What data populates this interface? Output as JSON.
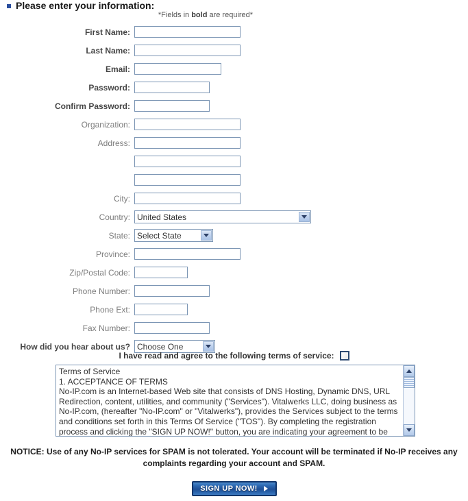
{
  "header": {
    "title": "Please enter your information:",
    "required_note_prefix": "*Fields in ",
    "required_note_bold": "bold",
    "required_note_suffix": " are required*"
  },
  "form": {
    "fields": [
      {
        "label": "First Name:",
        "required": true,
        "value": "",
        "type": "text"
      },
      {
        "label": "Last Name:",
        "required": true,
        "value": "",
        "type": "text"
      },
      {
        "label": "Email:",
        "required": true,
        "value": "",
        "type": "text"
      },
      {
        "label": "Password:",
        "required": true,
        "value": "",
        "type": "text"
      },
      {
        "label": "Confirm Password:",
        "required": true,
        "value": "",
        "type": "text"
      },
      {
        "label": "Organization:",
        "required": false,
        "value": "",
        "type": "text"
      },
      {
        "label": "Address:",
        "required": false,
        "value": "",
        "type": "text"
      },
      {
        "label": "",
        "required": false,
        "value": "",
        "type": "text"
      },
      {
        "label": "",
        "required": false,
        "value": "",
        "type": "text"
      },
      {
        "label": "City:",
        "required": false,
        "value": "",
        "type": "text"
      },
      {
        "label": "Country:",
        "required": false,
        "value": "United States",
        "type": "select"
      },
      {
        "label": "State:",
        "required": false,
        "value": "Select State",
        "type": "select"
      },
      {
        "label": "Province:",
        "required": false,
        "value": "",
        "type": "text"
      },
      {
        "label": "Zip/Postal Code:",
        "required": false,
        "value": "",
        "type": "text"
      },
      {
        "label": "Phone Number:",
        "required": false,
        "value": "",
        "type": "text"
      },
      {
        "label": "Phone Ext:",
        "required": false,
        "value": "",
        "type": "text"
      },
      {
        "label": "Fax Number:",
        "required": false,
        "value": "",
        "type": "text"
      },
      {
        "label": "How did you hear about us?",
        "required": true,
        "value": "Choose One",
        "type": "select"
      }
    ]
  },
  "agreement": {
    "label": "I have read and agree to the following terms of service:",
    "checked": false
  },
  "terms": {
    "text": "Terms of Service\n1. ACCEPTANCE OF TERMS\nNo-IP.com is an Internet-based Web site that consists of DNS Hosting, Dynamic DNS, URL Redirection, content, utilities, and community (\"Services\"). Vitalwerks LLC, doing business as No-IP.com, (hereafter \"No-IP.com\" or \"Vitalwerks\"), provides the Services subject to the terms and conditions set forth in this Terms Of Service (\"TOS\"). By completing the registration process and clicking the \"SIGN UP NOW!\" button, you are indicating your agreement to be bound by all of the terms and conditions of"
  },
  "notice": {
    "text": "NOTICE: Use of any No-IP services for SPAM is not tolerated. Your account will be terminated if No-IP receives any complaints regarding your account and SPAM."
  },
  "submit": {
    "label": "SIGN UP NOW!"
  },
  "colors": {
    "input_border": "#7b95b4",
    "bullet": "#2b4f9e",
    "button_border": "#11356b",
    "checkbox_border": "#2d4a72"
  }
}
